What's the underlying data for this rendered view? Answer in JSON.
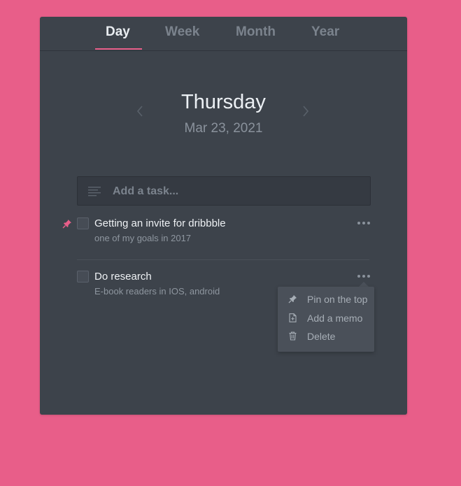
{
  "tabs": [
    {
      "label": "Day",
      "active": true
    },
    {
      "label": "Week",
      "active": false
    },
    {
      "label": "Month",
      "active": false
    },
    {
      "label": "Year",
      "active": false
    }
  ],
  "header": {
    "weekday": "Thursday",
    "date": "Mar 23, 2021",
    "prev_icon": "chevron-left-icon",
    "next_icon": "chevron-right-icon"
  },
  "add_task": {
    "placeholder": "Add a task...",
    "value": "",
    "icon": "lines-icon"
  },
  "tasks": [
    {
      "title": "Getting an invite for dribbble",
      "subtitle": "one of my goals in 2017",
      "pinned": true,
      "checked": false
    },
    {
      "title": "Do research",
      "subtitle": "E-book readers in IOS, android",
      "pinned": false,
      "checked": false
    }
  ],
  "context_menu": {
    "items": [
      {
        "label": "Pin on the top",
        "icon": "pin-icon"
      },
      {
        "label": "Add a memo",
        "icon": "memo-icon"
      },
      {
        "label": "Delete",
        "icon": "trash-icon"
      }
    ]
  },
  "colors": {
    "background": "#e85e89",
    "card": "#3d434b",
    "accent": "#e85e89"
  }
}
